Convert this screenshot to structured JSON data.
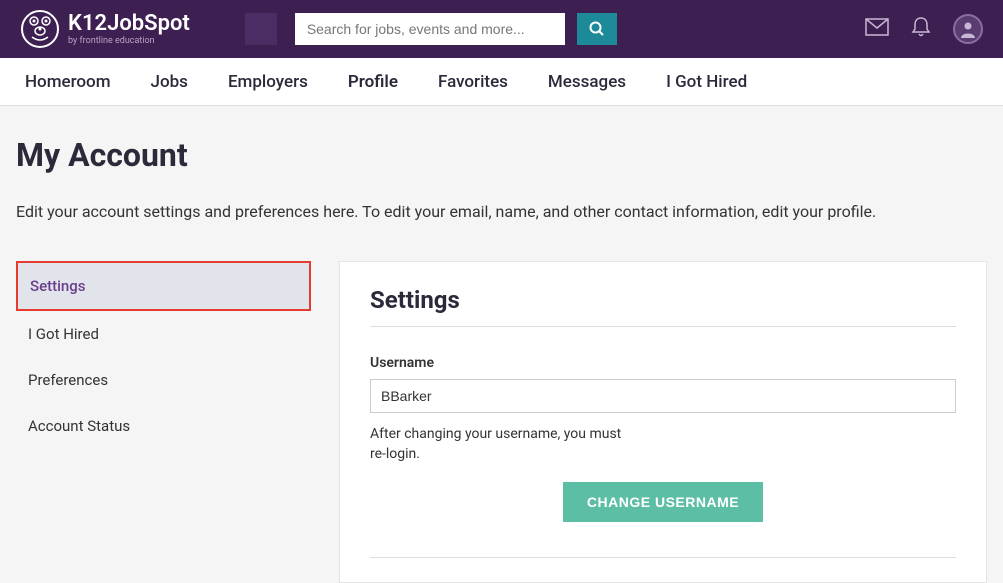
{
  "header": {
    "logo_main": "K12JobSpot",
    "logo_sub": "by frontline education",
    "search_placeholder": "Search for jobs, events and more..."
  },
  "nav": {
    "items": [
      "Homeroom",
      "Jobs",
      "Employers",
      "Profile",
      "Favorites",
      "Messages",
      "I Got Hired"
    ]
  },
  "page": {
    "title": "My Account",
    "description": "Edit your account settings and preferences here. To edit your email, name, and other contact information, edit your profile."
  },
  "sidebar": {
    "items": [
      "Settings",
      "I Got Hired",
      "Preferences",
      "Account Status"
    ]
  },
  "panel": {
    "title": "Settings",
    "username_label": "Username",
    "username_value": "BBarker",
    "username_help": "After changing your username, you must re-login.",
    "change_button": "CHANGE USERNAME"
  }
}
